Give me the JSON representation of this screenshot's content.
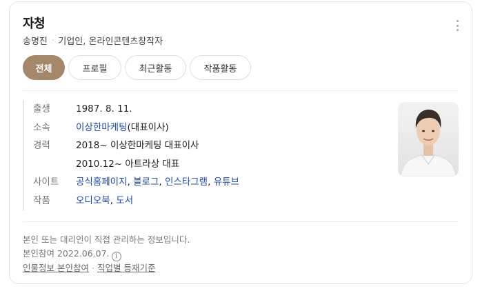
{
  "profile": {
    "name": "자청",
    "real_name": "송명진",
    "occupation": "기업인, 온라인콘텐츠창작자"
  },
  "tabs": [
    {
      "label": "전체",
      "active": true
    },
    {
      "label": "프로필",
      "active": false
    },
    {
      "label": "최근활동",
      "active": false
    },
    {
      "label": "작품활동",
      "active": false
    }
  ],
  "info": {
    "birth": {
      "label": "출생",
      "value": "1987. 8. 11."
    },
    "affiliation": {
      "label": "소속",
      "link": "이상한마케팅",
      "suffix": "(대표이사)"
    },
    "career": {
      "label": "경력",
      "items": [
        "2018~ 이상한마케팅 대표이사",
        "2010.12~ 아트라상 대표"
      ]
    },
    "sites": {
      "label": "사이트",
      "links": [
        "공식홈페이지",
        "블로그",
        "인스타그램",
        "유튜브"
      ]
    },
    "works": {
      "label": "작품",
      "links": [
        "오디오북",
        "도서"
      ]
    }
  },
  "footer": {
    "notice": "본인 또는 대리인이 직접 관리하는 정보입니다.",
    "participation": "본인참여 2022.06.07.",
    "info_icon": "i",
    "links": [
      "인물정보 본인참여",
      "직업별 등재기준"
    ]
  },
  "colors": {
    "active_tab": "#a6876a",
    "link": "#1a4bb3",
    "label": "#777777"
  },
  "icons": {
    "more": "vertical-ellipsis-icon",
    "info": "info-circle-icon"
  }
}
